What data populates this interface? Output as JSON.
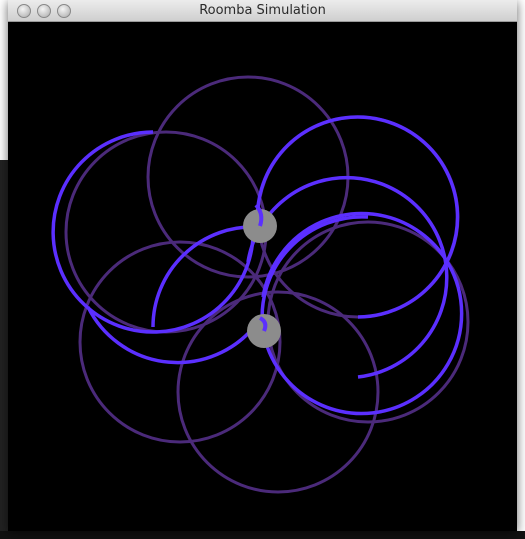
{
  "window": {
    "title": "Roomba Simulation",
    "buttons": [
      "close",
      "minimize",
      "zoom"
    ]
  },
  "simulation": {
    "background_color": "#000000",
    "robot_color": "#8c8c8c",
    "path_color_recent": "#5b2fff",
    "path_color_old": "#4b2a7a",
    "robot_count": 2
  }
}
